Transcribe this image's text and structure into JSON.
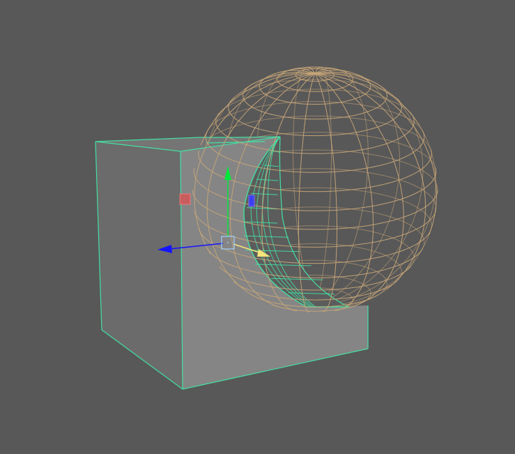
{
  "viewport": {
    "background": "#585858"
  },
  "scene": {
    "cube_object": {
      "selected": true,
      "face_colors": {
        "front": "#858585",
        "left_side": "#6b6b6b",
        "top": "#757575",
        "inner_cavity": "#5c5c5c"
      },
      "wireframe_color": "#43e0a3"
    },
    "sphere_object": {
      "selected": false,
      "wireframe_color": "#c8a678",
      "display": "wireframe"
    }
  },
  "manipulator": {
    "tool": "move",
    "axes": {
      "x": {
        "color": "#ff3a3a"
      },
      "y": {
        "color": "#00e83a"
      },
      "z": {
        "color": "#1414ff"
      },
      "view_plane_handle": {
        "color": "#f5e37a"
      },
      "center_handle": {
        "color": "#9ed0ff"
      }
    },
    "plane_handles": {
      "yz": "#d65555",
      "xy": "#3a3aff"
    }
  }
}
